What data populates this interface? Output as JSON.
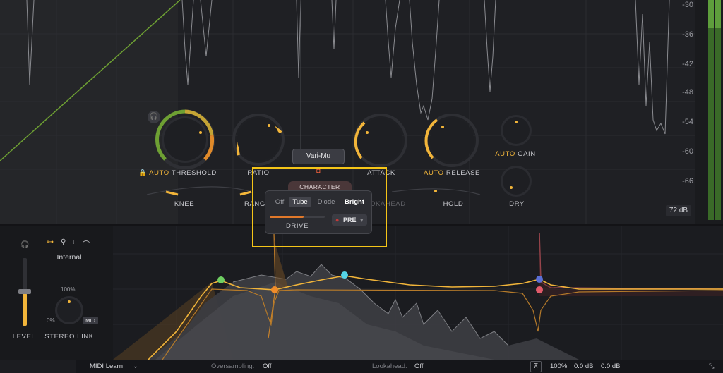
{
  "meter_scale": [
    "-30",
    "-36",
    "-42",
    "-48",
    "-54",
    "-60",
    "-66"
  ],
  "range_readout": "72 dB",
  "knobs": {
    "threshold": {
      "label": "THRESHOLD",
      "auto": "AUTO"
    },
    "ratio": {
      "label": "RATIO"
    },
    "attack": {
      "label": "ATTACK"
    },
    "release": {
      "label": "RELEASE",
      "auto": "AUTO"
    },
    "gain": {
      "label": "GAIN",
      "auto": "AUTO"
    },
    "dry": {
      "label": "DRY"
    },
    "knee": {
      "label": "KNEE"
    },
    "range": {
      "label": "RANG"
    },
    "lookahead": {
      "label": "OKAHEAD"
    },
    "hold": {
      "label": "HOLD"
    }
  },
  "style_button": "Vari-Mu",
  "character_popup": {
    "title": "CHARACTER",
    "options": [
      "Off",
      "Tube",
      "Diode",
      "Bright"
    ],
    "selected": "Tube",
    "drive_label": "DRIVE",
    "pre_label": "PRE"
  },
  "sidechain": {
    "source": "Internal",
    "level_label": "LEVEL",
    "stereo_link_label": "STEREO LINK",
    "stereo_top": "100%",
    "stereo_left": "0%",
    "stereo_mode": "MID"
  },
  "bottom_bar": {
    "midi_learn": "MIDI Learn",
    "oversampling_label": "Oversampling:",
    "oversampling_value": "Off",
    "lookahead_label": "Lookahead:",
    "lookahead_value": "Off",
    "zoom": "100%",
    "gain_1": "0.0 dB",
    "gain_2": "0.0 dB"
  },
  "colors": {
    "accent": "#f2b53a",
    "background": "#1c1d21",
    "highlight_box": "#f5c518",
    "meter_green": "#5e9e3c",
    "node_green": "#6fcf62",
    "node_cyan": "#55d4e6",
    "node_blue": "#5a6fd6",
    "node_red": "#e05a6a"
  }
}
